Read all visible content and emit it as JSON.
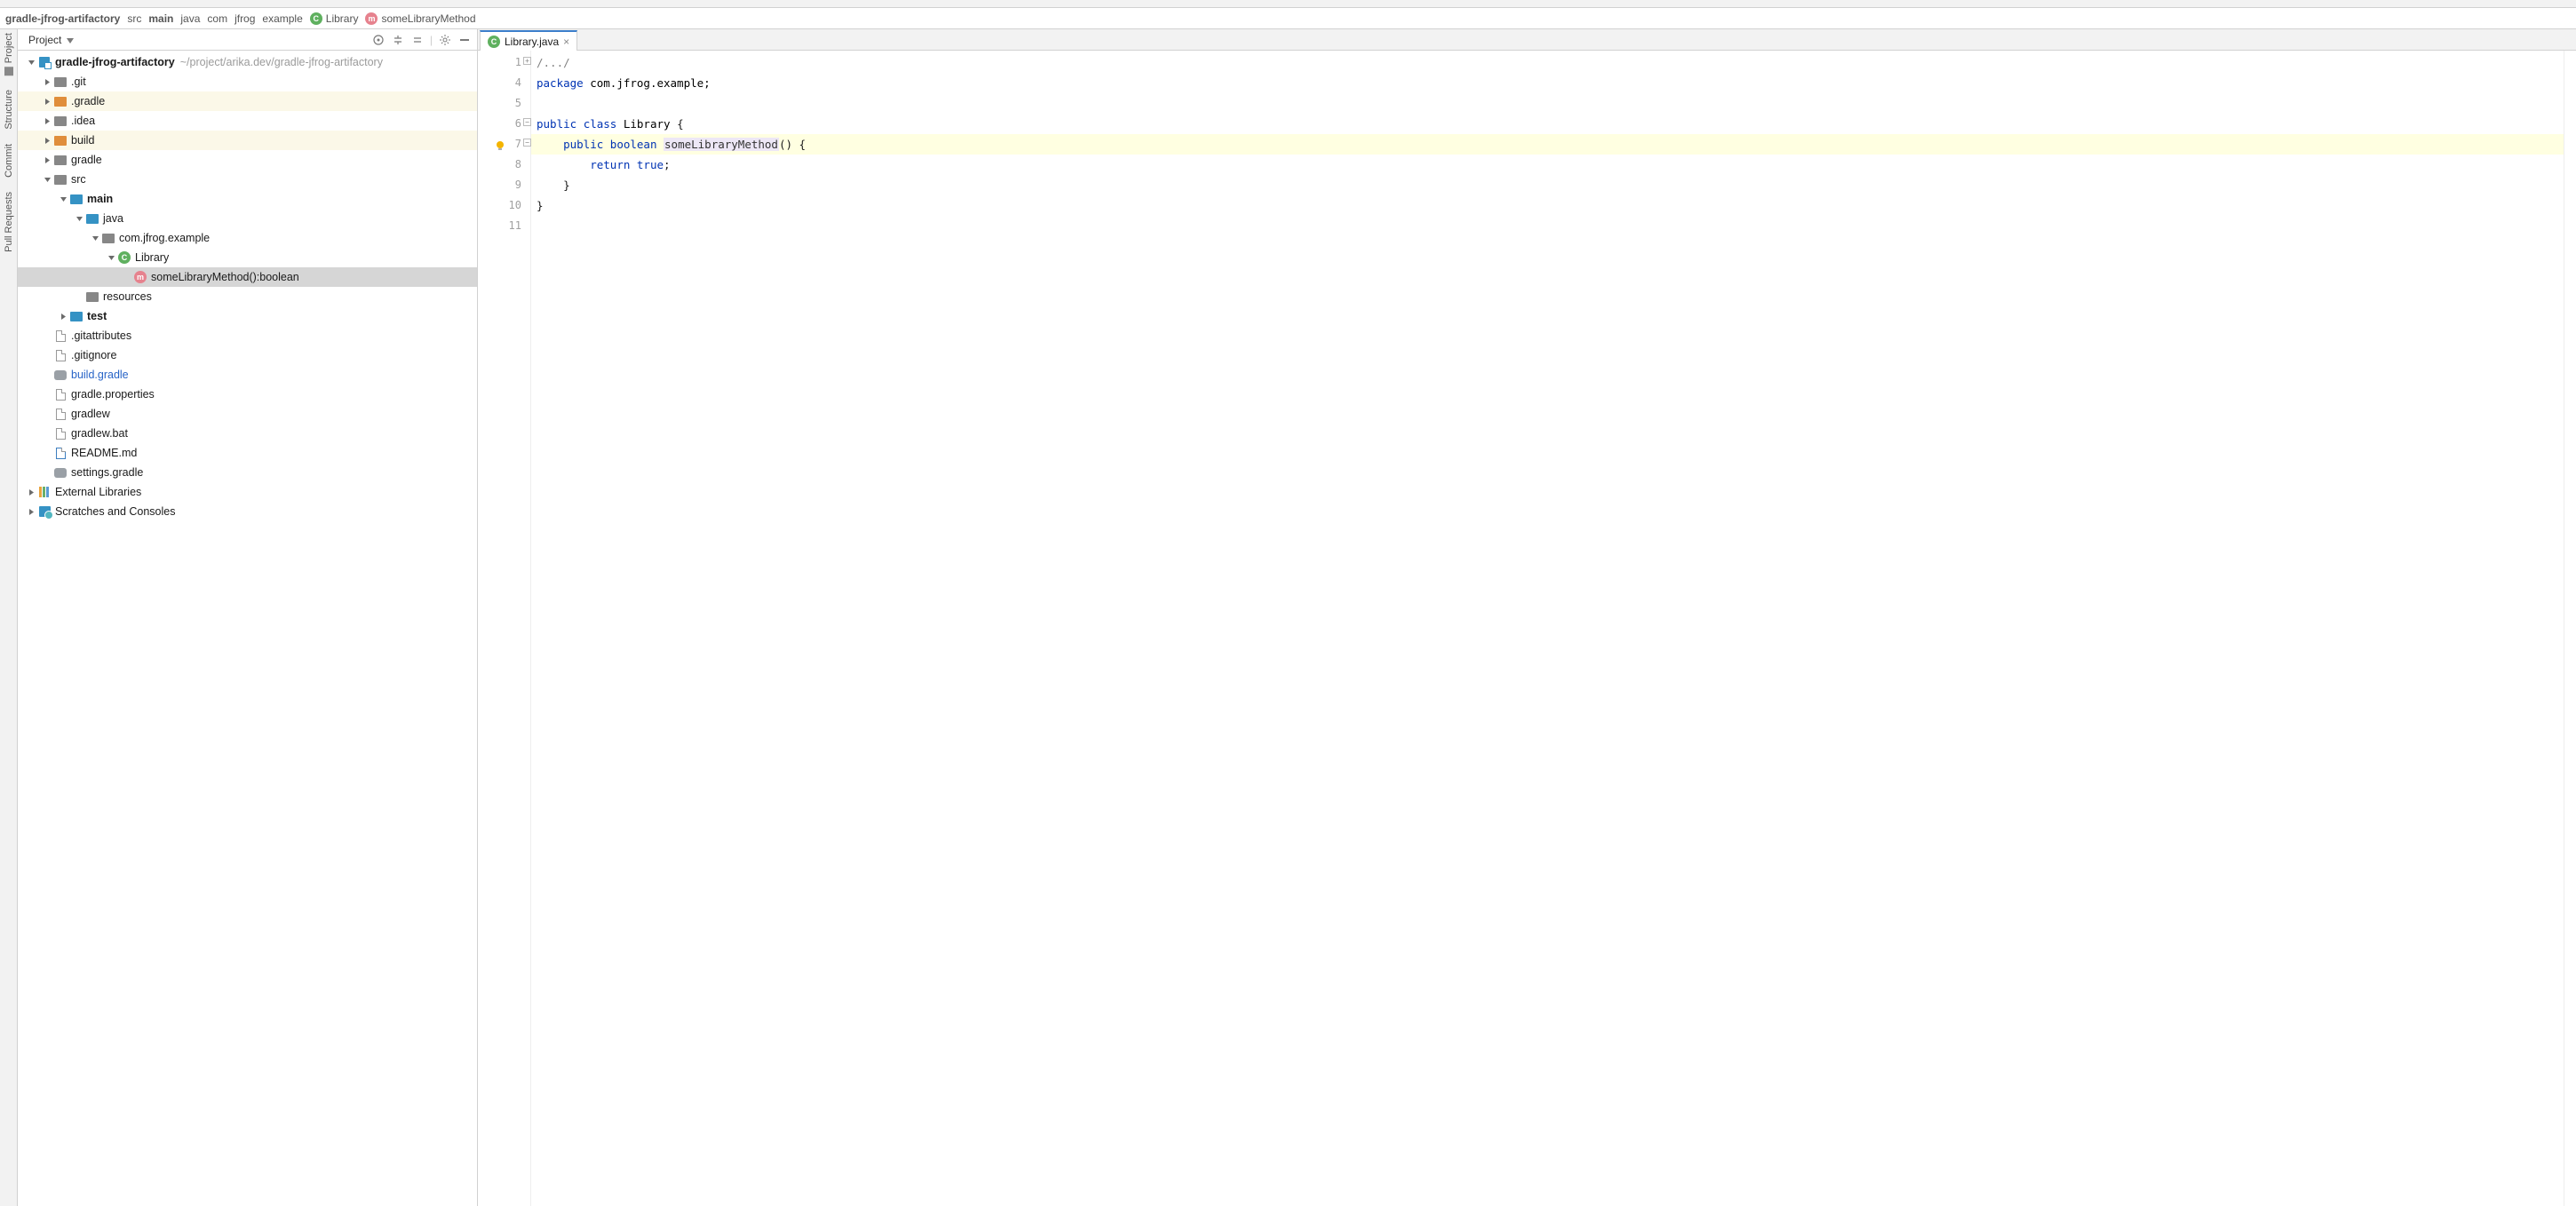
{
  "breadcrumbs": [
    {
      "label": "gradle-jfrog-artifactory",
      "bold": true
    },
    {
      "label": "src"
    },
    {
      "label": "main",
      "bold": true
    },
    {
      "label": "java"
    },
    {
      "label": "com"
    },
    {
      "label": "jfrog"
    },
    {
      "label": "example"
    },
    {
      "label": "Library",
      "icon": "class"
    },
    {
      "label": "someLibraryMethod",
      "icon": "method"
    }
  ],
  "leftbar": {
    "items": [
      {
        "label": "Project",
        "key": "project"
      },
      {
        "label": "Structure",
        "key": "structure"
      },
      {
        "label": "Commit",
        "key": "commit"
      },
      {
        "label": "Pull Requests",
        "key": "pullrequests"
      }
    ]
  },
  "projectPane": {
    "title": "Project",
    "rootName": "gradle-jfrog-artifactory",
    "rootPath": "~/project/arika.dev/gradle-jfrog-artifactory",
    "tree": [
      {
        "d": 1,
        "exp": "right",
        "icon": "folder-grey",
        "label": ".git"
      },
      {
        "d": 1,
        "exp": "right",
        "icon": "folder-orange",
        "label": ".gradle",
        "yellow": true
      },
      {
        "d": 1,
        "exp": "right",
        "icon": "folder-grey",
        "label": ".idea"
      },
      {
        "d": 1,
        "exp": "right",
        "icon": "folder-orange",
        "label": "build",
        "yellow": true
      },
      {
        "d": 1,
        "exp": "right",
        "icon": "folder-grey",
        "label": "gradle"
      },
      {
        "d": 1,
        "exp": "down",
        "icon": "folder-grey",
        "label": "src"
      },
      {
        "d": 2,
        "exp": "down",
        "icon": "folder-blue",
        "label": "main",
        "bold": true
      },
      {
        "d": 3,
        "exp": "down",
        "icon": "folder-blue",
        "label": "java"
      },
      {
        "d": 4,
        "exp": "down",
        "icon": "folder-grey",
        "label": "com.jfrog.example"
      },
      {
        "d": 5,
        "exp": "down",
        "icon": "class",
        "label": "Library"
      },
      {
        "d": 6,
        "exp": "none",
        "icon": "method",
        "label": "someLibraryMethod():boolean",
        "selected": true
      },
      {
        "d": 3,
        "exp": "none",
        "icon": "folder-grey",
        "label": "resources"
      },
      {
        "d": 2,
        "exp": "right",
        "icon": "folder-blue",
        "label": "test",
        "bold": true
      },
      {
        "d": 1,
        "exp": "none",
        "icon": "file",
        "label": ".gitattributes"
      },
      {
        "d": 1,
        "exp": "none",
        "icon": "file",
        "label": ".gitignore"
      },
      {
        "d": 1,
        "exp": "none",
        "icon": "elephant",
        "label": "build.gradle",
        "blueText": true
      },
      {
        "d": 1,
        "exp": "none",
        "icon": "file",
        "label": "gradle.properties"
      },
      {
        "d": 1,
        "exp": "none",
        "icon": "file",
        "label": "gradlew"
      },
      {
        "d": 1,
        "exp": "none",
        "icon": "file",
        "label": "gradlew.bat"
      },
      {
        "d": 1,
        "exp": "none",
        "icon": "file-md",
        "label": "README.md"
      },
      {
        "d": 1,
        "exp": "none",
        "icon": "elephant",
        "label": "settings.gradle"
      }
    ],
    "extLibs": "External Libraries",
    "scratches": "Scratches and Consoles"
  },
  "editor": {
    "tabName": "Library.java",
    "lineNumbers": [
      "1",
      "4",
      "5",
      "6",
      "7",
      "8",
      "9",
      "10",
      "11"
    ],
    "lines": [
      {
        "html": "<span class='comment'>/.../</span>",
        "fold": "plus"
      },
      {
        "html": "<span class='kw'>package</span> <span class='pkgpath'>com.jfrog.example;</span>"
      },
      {
        "html": ""
      },
      {
        "html": "<span class='kw'>public</span> <span class='kw'>class</span> <span class='cls'>Library</span> {",
        "fold": "minus"
      },
      {
        "html": "    <span class='kw'>public</span> <span class='kw'>boolean</span> <span class='mname'>someLibraryMethod</span>() {",
        "hl": true,
        "bulb": true,
        "fold": "minus"
      },
      {
        "html": "        <span class='kw'>return</span> <span class='kw'>true</span>;"
      },
      {
        "html": "    }",
        "fold": "end"
      },
      {
        "html": "}",
        "fold": "end"
      },
      {
        "html": ""
      }
    ]
  }
}
